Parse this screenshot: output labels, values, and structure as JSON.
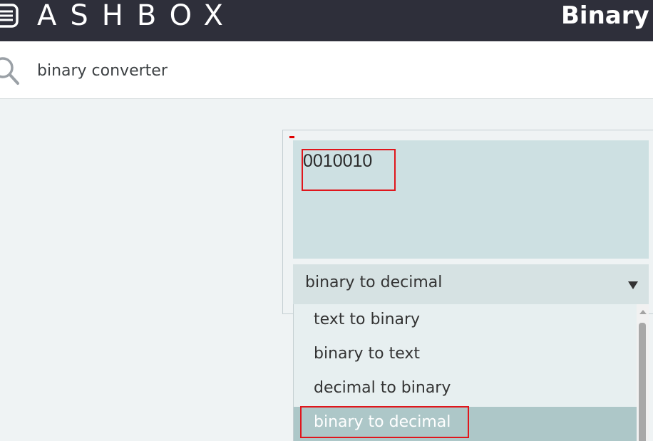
{
  "header": {
    "logo_text": "ASHBOX",
    "page_title": "Binary Translator"
  },
  "search": {
    "value": "binary converter"
  },
  "converter": {
    "input_value": "0010010",
    "selected_mode": "binary to decimal",
    "options": [
      {
        "label": "text to binary"
      },
      {
        "label": "binary to text"
      },
      {
        "label": "decimal to binary"
      },
      {
        "label": "binary to decimal"
      }
    ]
  },
  "colors": {
    "topbar": "#2e2f3a",
    "input_bg": "#cde0e2",
    "option_selected": "#adc7c8",
    "highlight": "#e0161c"
  }
}
